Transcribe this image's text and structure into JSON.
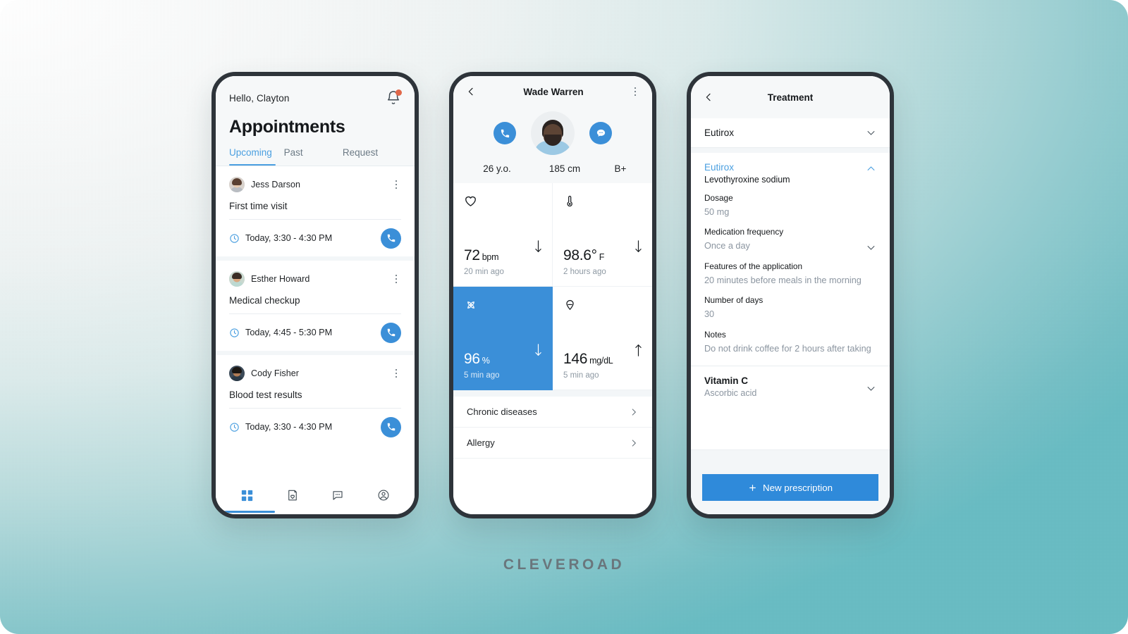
{
  "brand": "CLEVEROAD",
  "theme": {
    "accent_blue": "#3b8fd8",
    "link_blue": "#4a9fe0",
    "teal_bg": "#68bcc3",
    "frame_dark": "#2e343a",
    "notification_dot": "#e0684a"
  },
  "phone1": {
    "greeting": "Hello, Clayton",
    "bell_icon": "bell-icon",
    "page_title": "Appointments",
    "tabs": [
      {
        "label": "Upcoming",
        "active": true
      },
      {
        "label": "Past",
        "active": false
      },
      {
        "label": "Request",
        "active": false
      }
    ],
    "appointments": [
      {
        "name": "Jess Darson",
        "reason": "First time visit",
        "time": "Today, 3:30 - 4:30 PM",
        "avatar_bg": "#d9d3cd",
        "skin": "#e6c9ae",
        "hair": "#5a4031",
        "clothes": "#b9bdc2"
      },
      {
        "name": "Esther Howard",
        "reason": "Medical checkup",
        "time": "Today, 4:45 - 5:30 PM",
        "avatar_bg": "#c9d8cf",
        "skin": "#d9a77f",
        "hair": "#3a2d25",
        "clothes": "#bcd9d2"
      },
      {
        "name": "Cody Fisher",
        "reason": "Blood test results",
        "time": "Today, 3:30 - 4:30 PM",
        "avatar_bg": "#3c4a58",
        "skin": "#b07c56",
        "hair": "#1b1713",
        "clothes": "#2b3a47"
      }
    ],
    "nav": [
      {
        "name": "dashboard-grid-icon",
        "active": true
      },
      {
        "name": "records-heart-icon",
        "active": false
      },
      {
        "name": "chat-icon",
        "active": false
      },
      {
        "name": "profile-icon",
        "active": false
      }
    ]
  },
  "phone2": {
    "back_icon": "chevron-left-icon",
    "title": "Wade Warren",
    "menu_icon": "kebab-menu-icon",
    "call_icon": "phone-icon",
    "message_icon": "chat-bubble-icon",
    "stats": [
      {
        "value": "26 y.o."
      },
      {
        "value": "185 cm"
      },
      {
        "value": "B+"
      }
    ],
    "vitals": [
      {
        "icon": "heart-icon",
        "value": "72",
        "unit": "bpm",
        "ago": "20 min ago",
        "trend": "down",
        "highlight": false
      },
      {
        "icon": "thermometer-icon",
        "value": "98.6°",
        "unit": "F",
        "ago": "2 hours ago",
        "trend": "down",
        "highlight": false
      },
      {
        "icon": "oxygen-saturation-icon",
        "value": "96",
        "unit": "%",
        "ago": "5 min ago",
        "trend": "down",
        "highlight": true
      },
      {
        "icon": "blood-drop-icon",
        "value": "146",
        "unit": "mg/dL",
        "ago": "5 min ago",
        "trend": "up",
        "highlight": false
      }
    ],
    "links": [
      {
        "label": "Chronic diseases"
      },
      {
        "label": "Allergy"
      }
    ]
  },
  "phone3": {
    "back_icon": "chevron-left-icon",
    "title": "Treatment",
    "collapsed_item": {
      "label": "Eutirox",
      "chevron": "chevron-down-icon"
    },
    "expanded": {
      "name": "Eutirox",
      "generic": "Levothyroxine sodium",
      "chevron": "chevron-up-icon",
      "fields": [
        {
          "label": "Dosage",
          "value": "50 mg",
          "chevron": false
        },
        {
          "label": "Medication frequency",
          "value": "Once a day",
          "chevron": true
        },
        {
          "label": "Features of the application",
          "value": "20 minutes before meals in the morning",
          "chevron": false
        },
        {
          "label": "Number of days",
          "value": "30",
          "chevron": false
        },
        {
          "label": "Notes",
          "value": "Do not drink coffee for 2 hours after taking",
          "chevron": false
        }
      ]
    },
    "second_item": {
      "name": "Vitamin C",
      "generic": "Ascorbic acid",
      "chevron": "chevron-down-icon"
    },
    "primary_button": {
      "label": "New prescription",
      "icon": "plus-icon"
    }
  }
}
